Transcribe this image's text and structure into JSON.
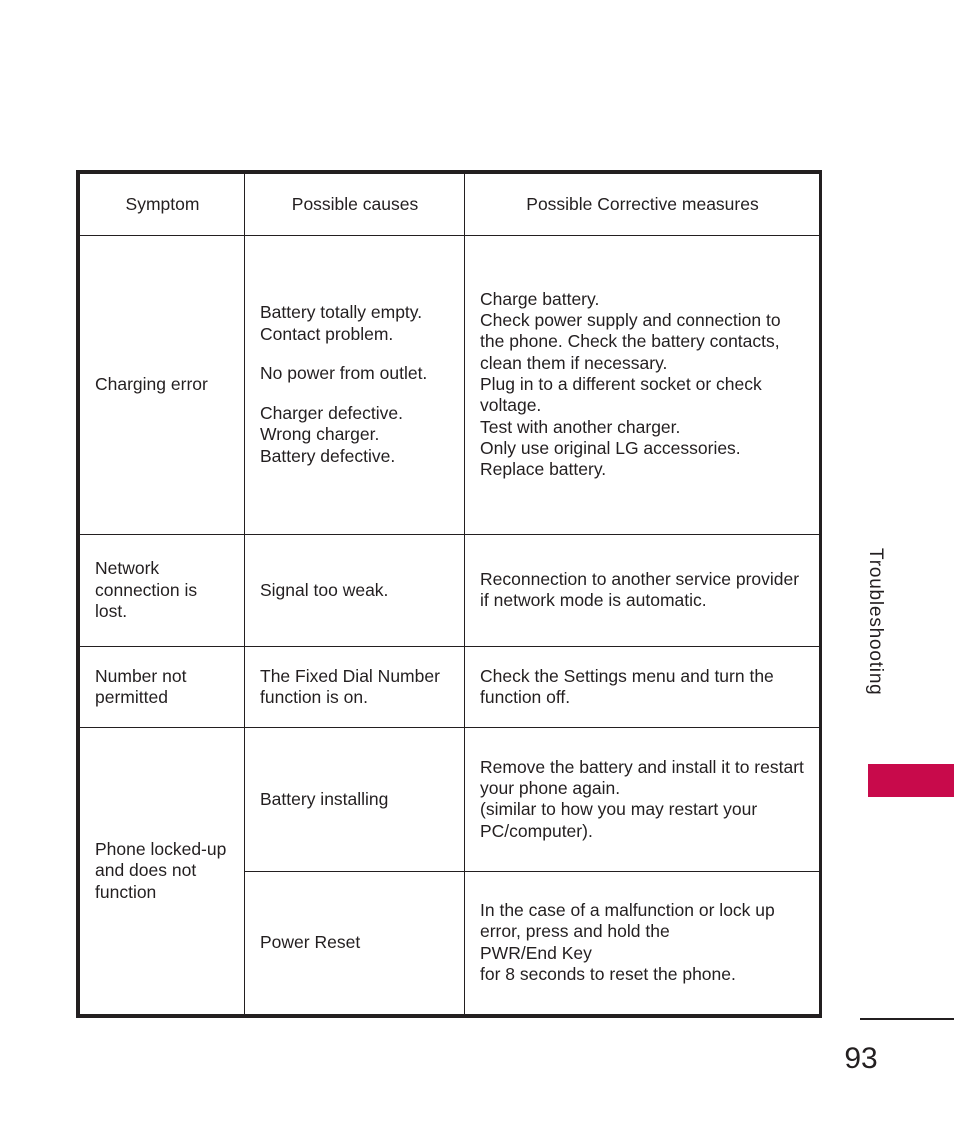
{
  "document": {
    "section_tab": "Troubleshooting",
    "page_number": "93",
    "accent_color": "#c80a4b",
    "text_color": "#231f20"
  },
  "table": {
    "headers": {
      "symptom": "Symptom",
      "causes": "Possible causes",
      "measures": "Possible Corrective measures"
    },
    "rows": [
      {
        "symptom": "Charging error",
        "causes": [
          "Battery totally empty.",
          "Contact problem.",
          "No power from outlet.",
          "Charger defective.",
          "Wrong charger.",
          "Battery defective."
        ],
        "measures": [
          "Charge battery.",
          "Check power supply and connection to the phone. Check the battery contacts, clean them if necessary.",
          "Plug in to a different socket or check voltage.",
          "Test with another charger.",
          "Only use original LG accessories.",
          "Replace battery."
        ]
      },
      {
        "symptom": "Network connection is lost.",
        "causes": [
          "Signal too weak."
        ],
        "measures": [
          "Reconnection to another service provider if network mode is automatic."
        ]
      },
      {
        "symptom": "Number not permitted",
        "causes": [
          "The Fixed Dial Number function is on."
        ],
        "measures": [
          "Check the Settings menu and turn the function off."
        ]
      },
      {
        "symptom": "Phone locked-up and does not function",
        "subrows": [
          {
            "causes": [
              "Battery installing"
            ],
            "measures": [
              "Remove the battery and install it to restart your phone again.",
              "(similar to how you may restart your PC/computer)."
            ]
          },
          {
            "causes": [
              "Power Reset"
            ],
            "measures": [
              "In the case of a malfunction or lock up error, press and hold the",
              "PWR/End Key",
              "for 8 seconds to reset the phone."
            ]
          }
        ]
      }
    ]
  }
}
